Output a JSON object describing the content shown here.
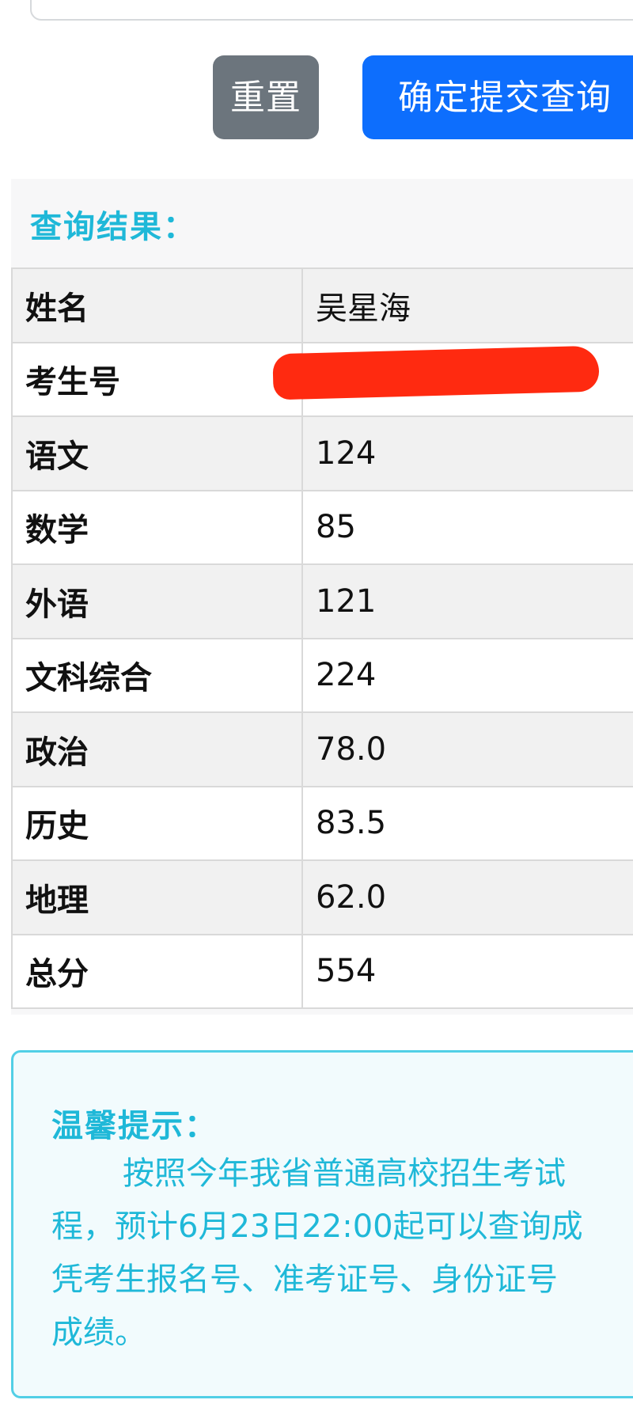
{
  "buttons": {
    "reset_label": "重置",
    "submit_label": "确定提交查询"
  },
  "result": {
    "title": "查询结果：",
    "rows": [
      {
        "label": "姓名",
        "value": "吴星海"
      },
      {
        "label": "考生号",
        "value": ""
      },
      {
        "label": "语文",
        "value": "124"
      },
      {
        "label": "数学",
        "value": "85"
      },
      {
        "label": "外语",
        "value": "121"
      },
      {
        "label": "文科综合",
        "value": "224"
      },
      {
        "label": "政治",
        "value": "78.0"
      },
      {
        "label": "历史",
        "value": "83.5"
      },
      {
        "label": "地理",
        "value": "62.0"
      },
      {
        "label": "总分",
        "value": "554"
      }
    ]
  },
  "tip": {
    "title": "温馨提示：",
    "lines": [
      "按照今年我省普通高校招生考试",
      "程，预计6月23日22:00起可以查询成",
      "凭考生报名号、准考证号、身份证号",
      "成绩。"
    ]
  },
  "colors": {
    "accent": "#1fb8d8",
    "reset_button": "#6c757d",
    "submit_button": "#0d6efd",
    "redaction": "#ff2a10"
  }
}
